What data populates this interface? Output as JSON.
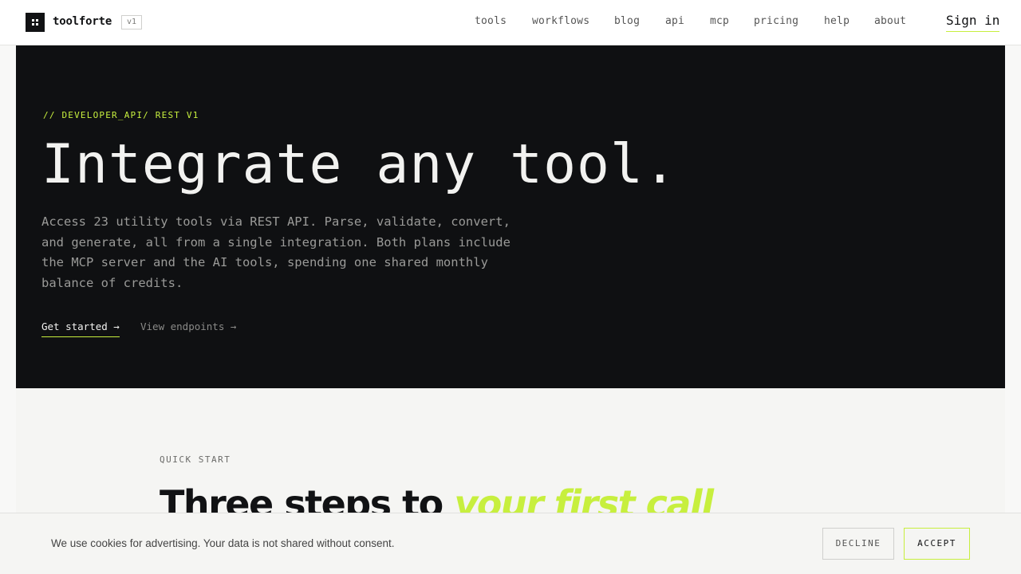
{
  "header": {
    "brand": "toolforte",
    "version": "v1",
    "nav": [
      "tools",
      "workflows",
      "blog",
      "api",
      "mcp",
      "pricing",
      "help",
      "about"
    ],
    "signin": "Sign in"
  },
  "hero": {
    "eyebrow": "// DEVELOPER_API/ REST V1",
    "title": "Integrate any tool.",
    "description": "Access 23 utility tools via REST API. Parse, validate, convert, and generate, all from a single integration. Both plans include the MCP server and the AI tools, spending one shared monthly balance of credits.",
    "cta_primary": "Get started →",
    "cta_secondary": "View endpoints →"
  },
  "quickstart": {
    "label": "QUICK START",
    "title_start": "Three steps to",
    "title_accent": "your first call"
  },
  "cookie": {
    "text": "We use cookies for advertising. Your data is not shared without consent.",
    "decline": "DECLINE",
    "accept": "ACCEPT"
  },
  "colors": {
    "accent": "#c7ef3e",
    "hero_bg": "#0f1012",
    "ink": "#111214"
  }
}
